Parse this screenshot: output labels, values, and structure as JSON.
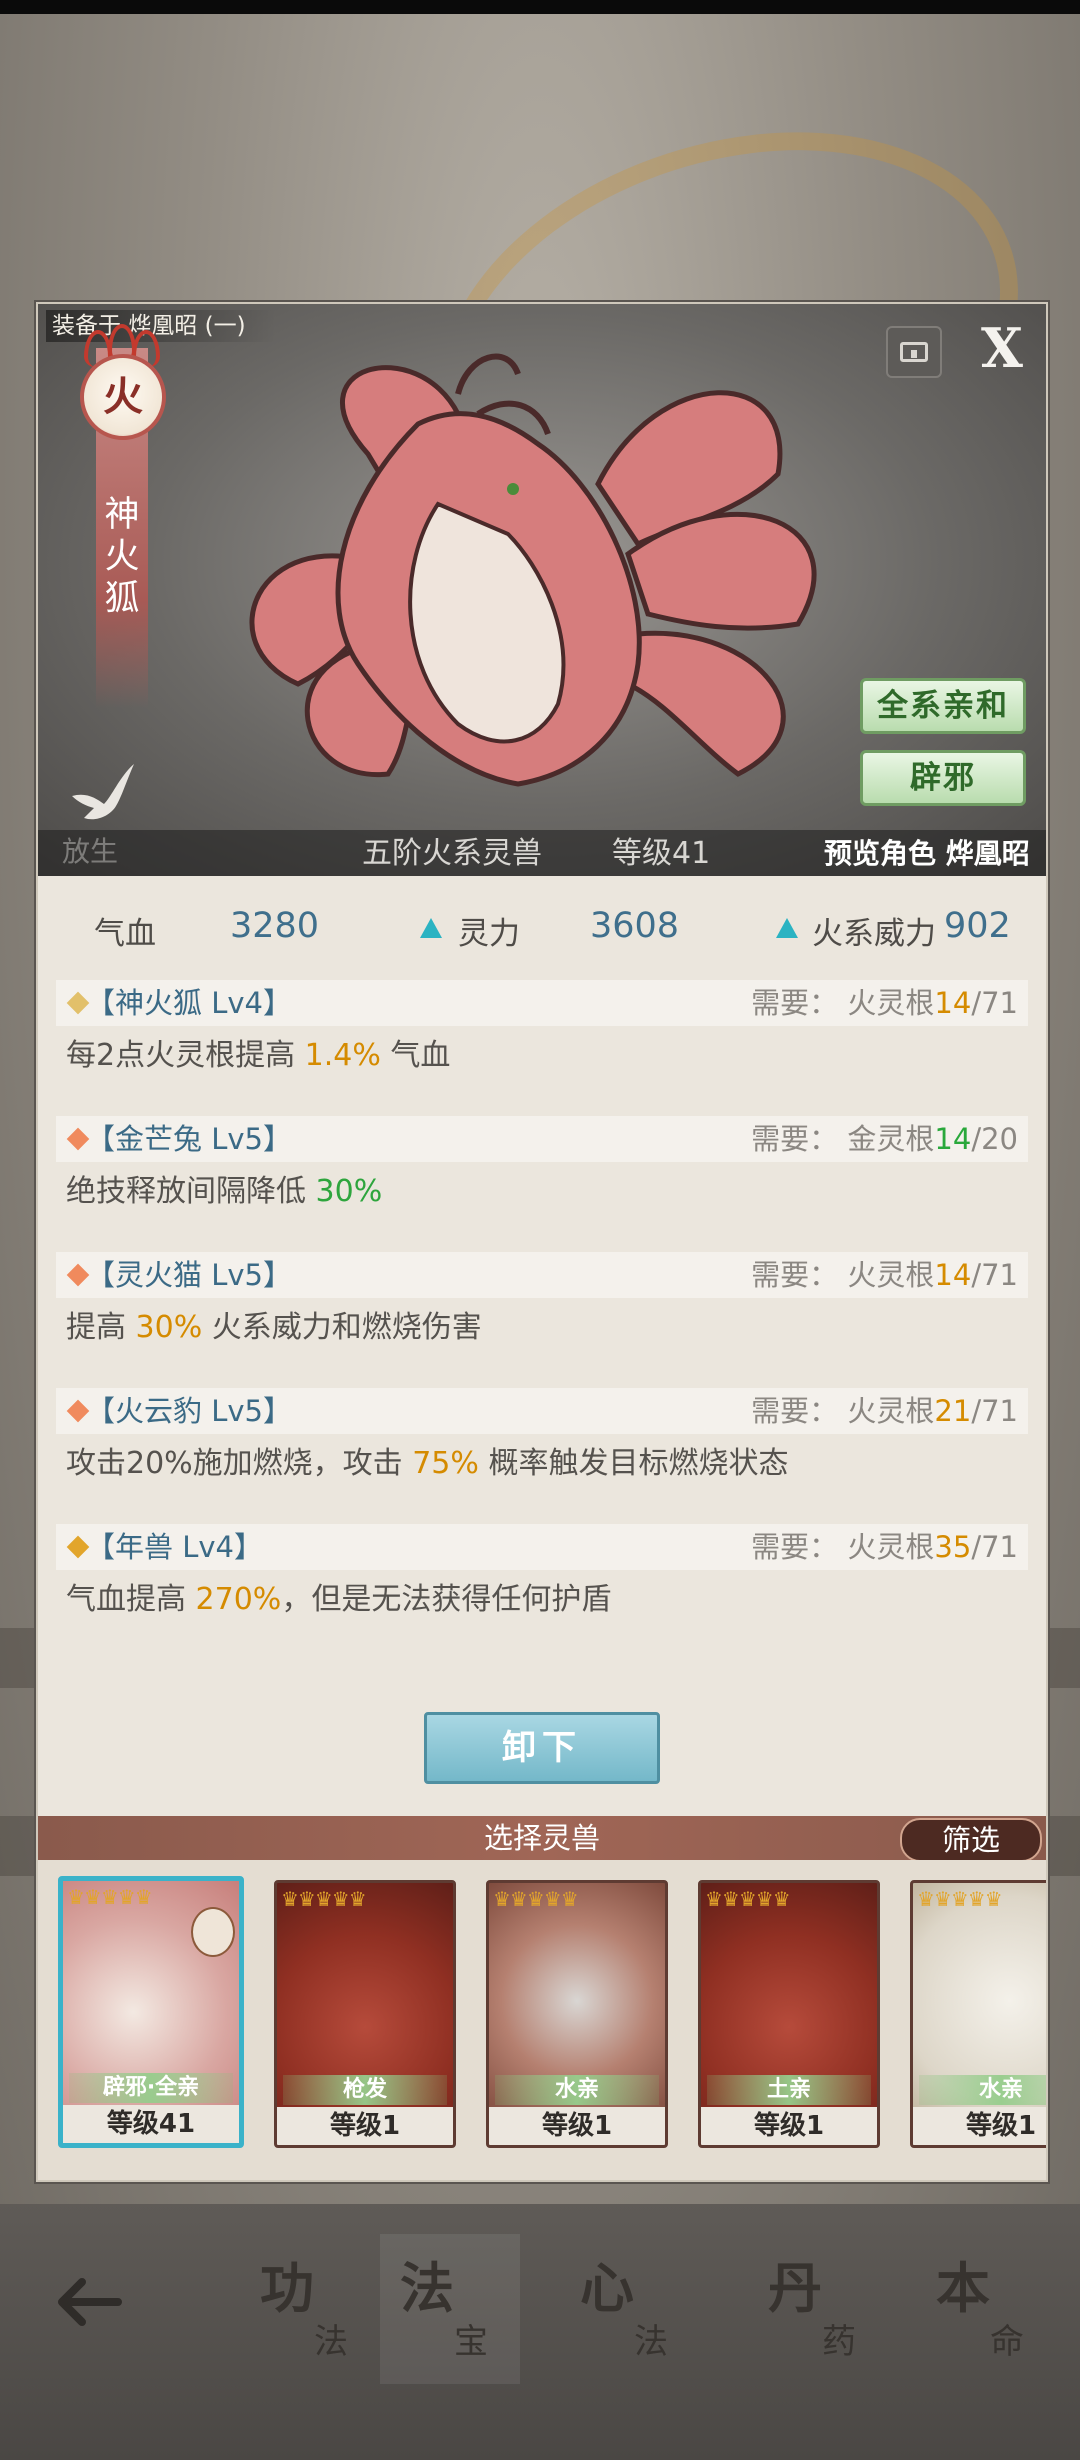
{
  "header": {
    "equipped_on": "装备于 烨凰昭 (一)",
    "close_label": "X"
  },
  "beast": {
    "element": "火",
    "name": "神火狐",
    "release_label": "放生",
    "tier": "五阶火系灵兽",
    "level": "等级41",
    "preview": "预览角色 烨凰昭",
    "affinity_tags": [
      "全系亲和",
      "辟邪"
    ]
  },
  "stats": [
    {
      "label": "气血",
      "value": "3280",
      "arrow": false
    },
    {
      "label": "灵力",
      "value": "3608",
      "arrow": true
    },
    {
      "label": "火系威力",
      "value": "902",
      "arrow": true
    }
  ],
  "skills": [
    {
      "title": "【神火狐 Lv4】",
      "icon_color": "#e2c06a",
      "req_prefix": "需要：",
      "req_root": "火灵根",
      "req_have": "14",
      "req_need": "/71",
      "have_color": "orange",
      "desc_before": "每2点火灵根提高 ",
      "desc_hl": "1.4%",
      "desc_after": " 气血",
      "hl_color": "orange"
    },
    {
      "title": "【金芒兔 Lv5】",
      "icon_color": "#f08a5d",
      "req_prefix": "需要：",
      "req_root": "金灵根",
      "req_have": "14",
      "req_need": "/20",
      "have_color": "green",
      "desc_before": "绝技释放间隔降低 ",
      "desc_hl": "30%",
      "desc_after": "",
      "hl_color": "green"
    },
    {
      "title": "【灵火猫 Lv5】",
      "icon_color": "#f08a5d",
      "req_prefix": "需要：",
      "req_root": "火灵根",
      "req_have": "14",
      "req_need": "/71",
      "have_color": "orange",
      "desc_before": "提高 ",
      "desc_hl": "30%",
      "desc_after": " 火系威力和燃烧伤害",
      "hl_color": "orange"
    },
    {
      "title": "【火云豹 Lv5】",
      "icon_color": "#f08a5d",
      "req_prefix": "需要：",
      "req_root": "火灵根",
      "req_have": "21",
      "req_need": "/71",
      "have_color": "orange",
      "desc_before": "攻击20%施加燃烧，攻击 ",
      "desc_hl": "75%",
      "desc_after": " 概率触发目标燃烧状态",
      "hl_color": "orange"
    },
    {
      "title": "【年兽 Lv4】",
      "icon_color": "#e2a52b",
      "req_prefix": "需要：",
      "req_root": "火灵根",
      "req_have": "35",
      "req_need": "/71",
      "have_color": "orange",
      "desc_before": "气血提高 ",
      "desc_hl": "270%",
      "desc_after": "，但是无法获得任何护盾",
      "hl_color": "orange"
    }
  ],
  "unequip_label": "卸下",
  "select": {
    "title": "选择灵兽",
    "filter_label": "筛选"
  },
  "cards": [
    {
      "tag": "辟邪·全亲",
      "level": "等级41",
      "stars": "♛♛♛♛♛",
      "selected": true,
      "theme": "fox"
    },
    {
      "tag": "枪发",
      "level": "等级1",
      "stars": "♛♛♛♛♛",
      "selected": false,
      "theme": "red"
    },
    {
      "tag": "水亲",
      "level": "等级1",
      "stars": "♛♛♛♛♛",
      "selected": false,
      "theme": "sage"
    },
    {
      "tag": "土亲",
      "level": "等级1",
      "stars": "♛♛♛♛♛",
      "selected": false,
      "theme": "red"
    },
    {
      "tag": "水亲",
      "level": "等级1",
      "stars": "♛♛♛♛♛",
      "selected": false,
      "theme": "white"
    }
  ],
  "nav": [
    {
      "big": "功",
      "small": "法"
    },
    {
      "big": "法",
      "small": "宝"
    },
    {
      "big": "心",
      "small": "法"
    },
    {
      "big": "丹",
      "small": "药"
    },
    {
      "big": "本",
      "small": "命"
    }
  ]
}
